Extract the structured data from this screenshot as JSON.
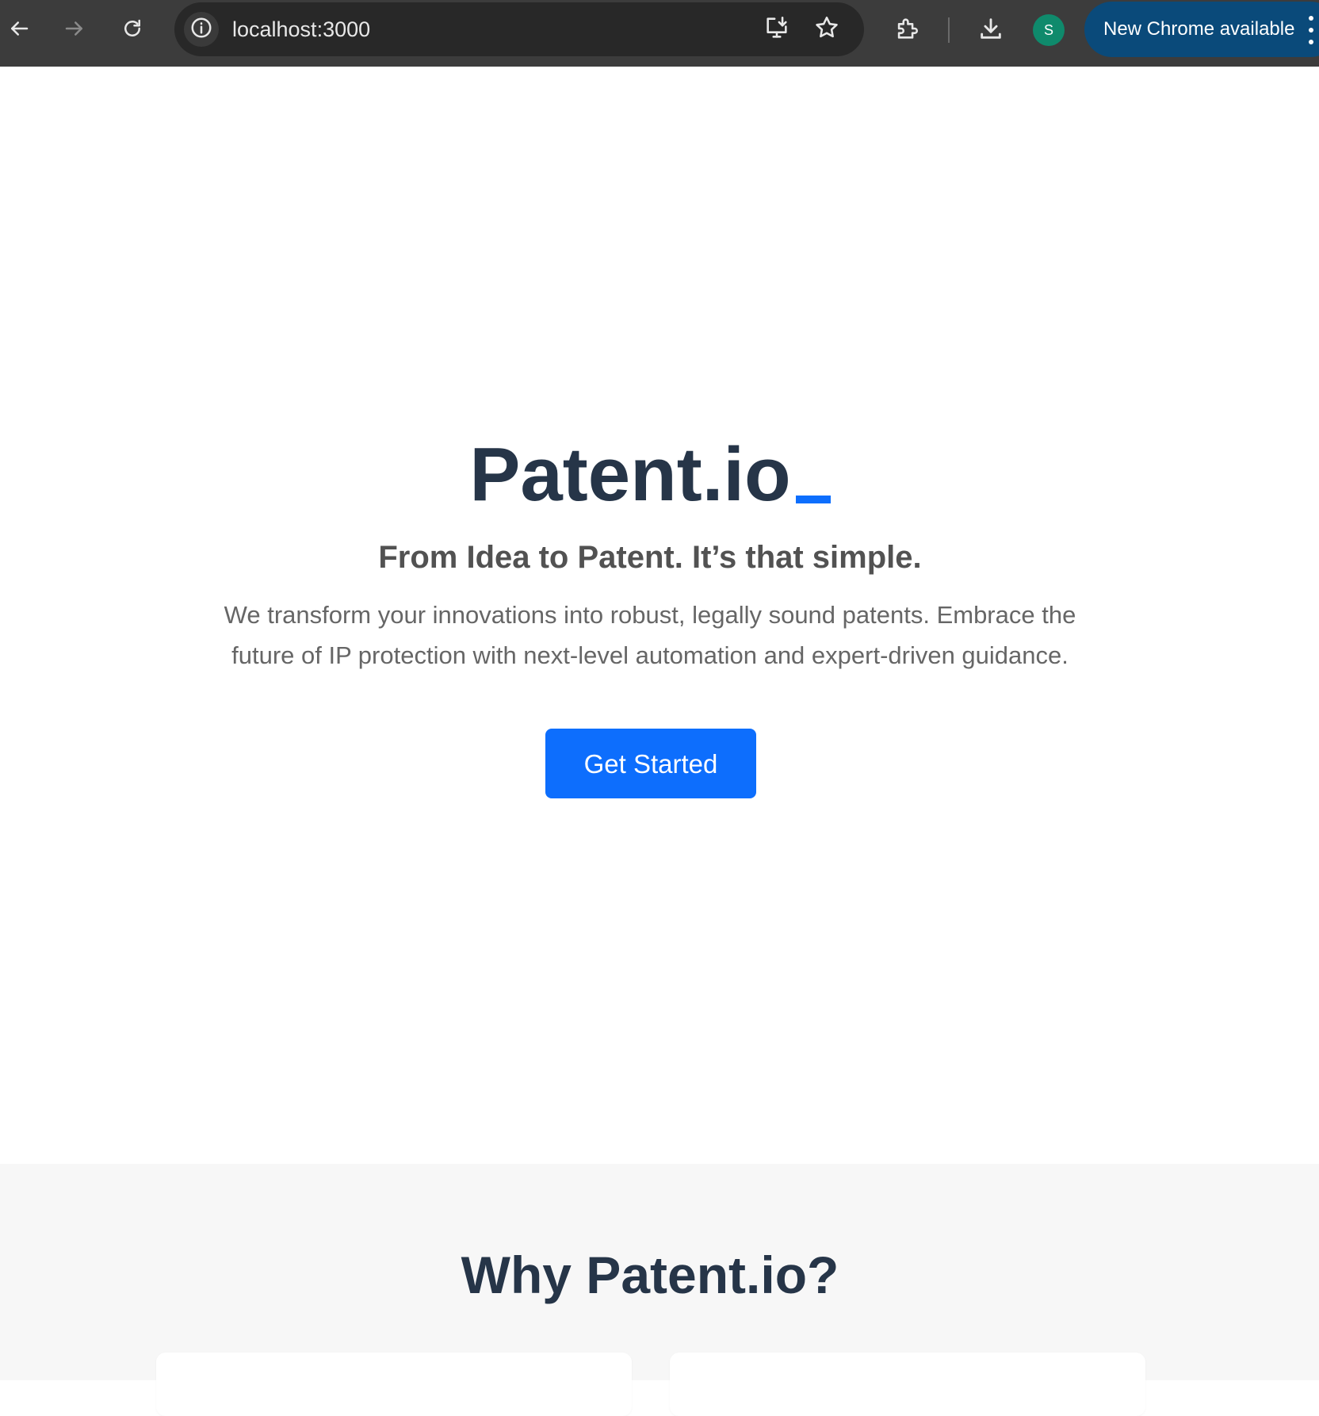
{
  "browser": {
    "url": "localhost:3000",
    "update_label": "New Chrome available",
    "profile_initial": "S",
    "icons": {
      "back": "back-arrow-icon",
      "forward": "forward-arrow-icon",
      "reload": "reload-icon",
      "site_info": "info-icon",
      "install": "install-app-icon",
      "bookmark": "star-icon",
      "extensions": "puzzle-icon",
      "downloads": "download-icon",
      "menu": "kebab-menu-icon"
    }
  },
  "hero": {
    "title": "Patent.io",
    "subtitle": "From Idea to Patent. It’s that simple.",
    "description": "We transform your innovations into robust, legally sound patents. Embrace the future of IP protection with next-level automation and expert-driven guidance.",
    "cta_label": "Get Started"
  },
  "features": {
    "title": "Why Patent.io?"
  },
  "colors": {
    "accent": "#0d6efd",
    "heading": "#263548",
    "chrome_bg": "#3c3c3c",
    "update_pill": "#0a4a7a",
    "avatar": "#0f8a6c",
    "section_bg": "#f7f7f7"
  }
}
